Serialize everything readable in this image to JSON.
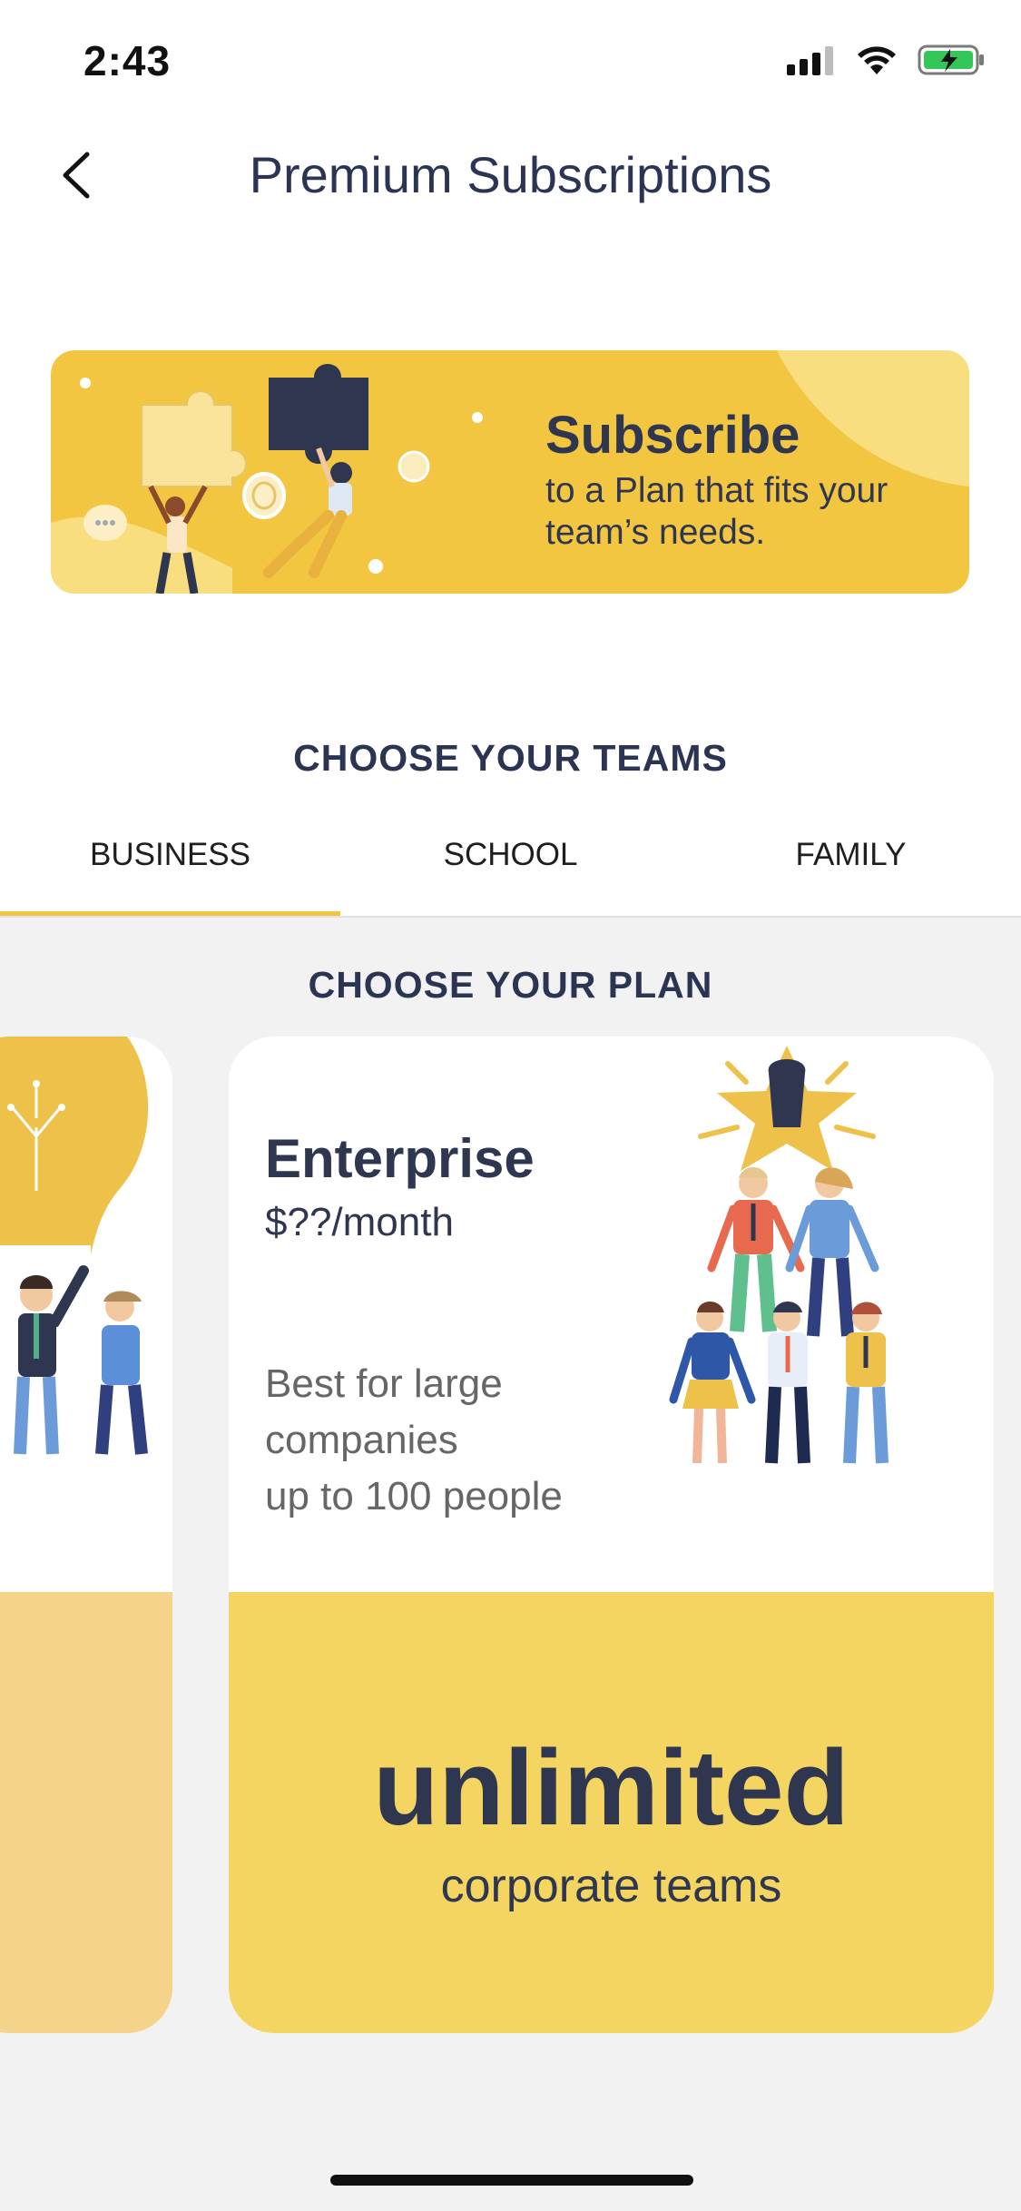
{
  "status_bar": {
    "time": "2:43"
  },
  "header": {
    "title": "Premium Subscriptions"
  },
  "banner": {
    "title": "Subscribe",
    "subtitle_line1": "to a Plan that fits your",
    "subtitle_line2": "team’s needs."
  },
  "teams": {
    "title": "CHOOSE YOUR TEAMS",
    "tabs": [
      {
        "label": "BUSINESS",
        "active": true
      },
      {
        "label": "SCHOOL",
        "active": false
      },
      {
        "label": "FAMILY",
        "active": false
      }
    ]
  },
  "plans": {
    "title": "CHOOSE YOUR PLAN",
    "current": {
      "name": "Enterprise",
      "price": "$??/month",
      "desc_line1": "Best for large",
      "desc_line2": "companies",
      "desc_line3": "up to 100 people",
      "highlight": "unlimited",
      "highlight_sub": "corporate teams"
    }
  },
  "colors": {
    "accent_yellow": "#f3c642",
    "dark_navy": "#2b3553"
  }
}
